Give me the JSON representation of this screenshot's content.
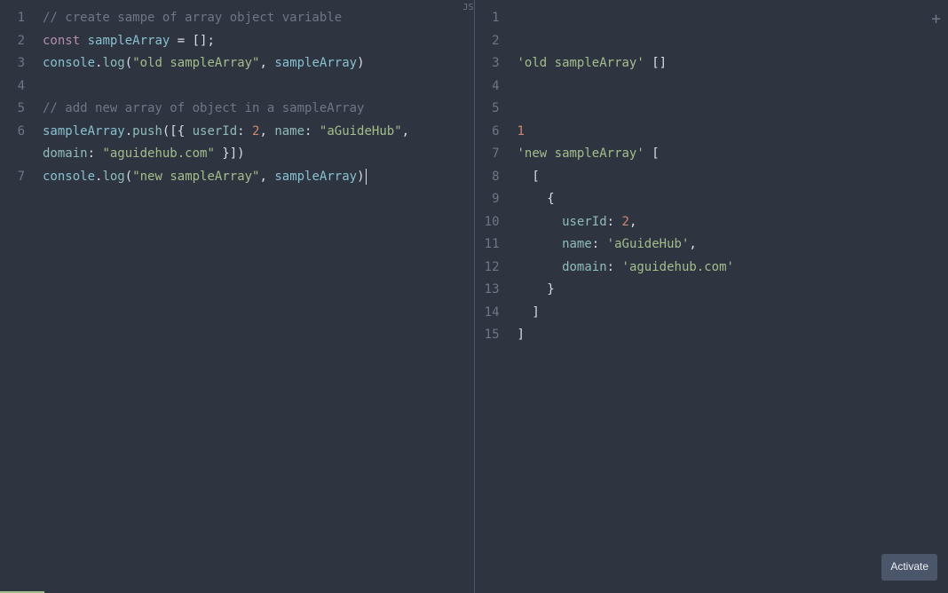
{
  "leftPane": {
    "lines": [
      "1",
      "2",
      "3",
      "4",
      "5",
      "6",
      "",
      "7"
    ],
    "code": [
      [
        {
          "t": "comment",
          "v": "// create sampe of array object variable"
        }
      ],
      [
        {
          "t": "keyword",
          "v": "const"
        },
        {
          "t": "plain",
          "v": " "
        },
        {
          "t": "name",
          "v": "sampleArray"
        },
        {
          "t": "plain",
          "v": " "
        },
        {
          "t": "punct",
          "v": "="
        },
        {
          "t": "plain",
          "v": " "
        },
        {
          "t": "punct",
          "v": "[];"
        }
      ],
      [
        {
          "t": "name",
          "v": "console"
        },
        {
          "t": "punct",
          "v": "."
        },
        {
          "t": "method",
          "v": "log"
        },
        {
          "t": "punct",
          "v": "("
        },
        {
          "t": "string",
          "v": "\"old sampleArray\""
        },
        {
          "t": "punct",
          "v": ", "
        },
        {
          "t": "name",
          "v": "sampleArray"
        },
        {
          "t": "punct",
          "v": ")"
        }
      ],
      [],
      [
        {
          "t": "comment",
          "v": "// add new array of object in a sampleArray"
        }
      ],
      [
        {
          "t": "name",
          "v": "sampleArray"
        },
        {
          "t": "punct",
          "v": "."
        },
        {
          "t": "method",
          "v": "push"
        },
        {
          "t": "punct",
          "v": "([{ "
        },
        {
          "t": "objkey",
          "v": "userId"
        },
        {
          "t": "punct",
          "v": ": "
        },
        {
          "t": "number",
          "v": "2"
        },
        {
          "t": "punct",
          "v": ", "
        },
        {
          "t": "objkey",
          "v": "name"
        },
        {
          "t": "punct",
          "v": ": "
        },
        {
          "t": "string",
          "v": "\"aGuideHub\""
        },
        {
          "t": "punct",
          "v": ","
        }
      ],
      [
        {
          "t": "objkey",
          "v": "domain"
        },
        {
          "t": "punct",
          "v": ": "
        },
        {
          "t": "string",
          "v": "\"aguidehub.com\""
        },
        {
          "t": "punct",
          "v": " }])"
        }
      ],
      [
        {
          "t": "name",
          "v": "console"
        },
        {
          "t": "punct",
          "v": "."
        },
        {
          "t": "method",
          "v": "log"
        },
        {
          "t": "punct",
          "v": "("
        },
        {
          "t": "string",
          "v": "\"new sampleArray\""
        },
        {
          "t": "punct",
          "v": ", "
        },
        {
          "t": "name",
          "v": "sampleArray"
        },
        {
          "t": "punct",
          "v": ")"
        },
        {
          "t": "cursor",
          "v": ""
        }
      ]
    ]
  },
  "rightPane": {
    "lines": [
      "1",
      "2",
      "3",
      "4",
      "5",
      "6",
      "7",
      "8",
      "9",
      "10",
      "11",
      "12",
      "13",
      "14",
      "15"
    ],
    "code": [
      [],
      [],
      [
        {
          "t": "string",
          "v": "'old sampleArray'"
        },
        {
          "t": "plain",
          "v": " "
        },
        {
          "t": "punct",
          "v": "[]"
        }
      ],
      [],
      [],
      [
        {
          "t": "number",
          "v": "1"
        }
      ],
      [
        {
          "t": "string",
          "v": "'new sampleArray'"
        },
        {
          "t": "plain",
          "v": " "
        },
        {
          "t": "punct",
          "v": "["
        }
      ],
      [
        {
          "t": "plain",
          "v": "  "
        },
        {
          "t": "punct",
          "v": "["
        }
      ],
      [
        {
          "t": "plain",
          "v": "    "
        },
        {
          "t": "punct",
          "v": "{"
        }
      ],
      [
        {
          "t": "plain",
          "v": "      "
        },
        {
          "t": "objkey",
          "v": "userId"
        },
        {
          "t": "punct",
          "v": ": "
        },
        {
          "t": "number",
          "v": "2"
        },
        {
          "t": "punct",
          "v": ","
        }
      ],
      [
        {
          "t": "plain",
          "v": "      "
        },
        {
          "t": "objkey",
          "v": "name"
        },
        {
          "t": "punct",
          "v": ": "
        },
        {
          "t": "string",
          "v": "'aGuideHub'"
        },
        {
          "t": "punct",
          "v": ","
        }
      ],
      [
        {
          "t": "plain",
          "v": "      "
        },
        {
          "t": "objkey",
          "v": "domain"
        },
        {
          "t": "punct",
          "v": ": "
        },
        {
          "t": "string",
          "v": "'aguidehub.com'"
        }
      ],
      [
        {
          "t": "plain",
          "v": "    "
        },
        {
          "t": "punct",
          "v": "}"
        }
      ],
      [
        {
          "t": "plain",
          "v": "  "
        },
        {
          "t": "punct",
          "v": "]"
        }
      ],
      [
        {
          "t": "punct",
          "v": "]"
        }
      ]
    ]
  },
  "ui": {
    "addIcon": "+",
    "activateLabel": "Activate",
    "tabMarker": "JS"
  }
}
